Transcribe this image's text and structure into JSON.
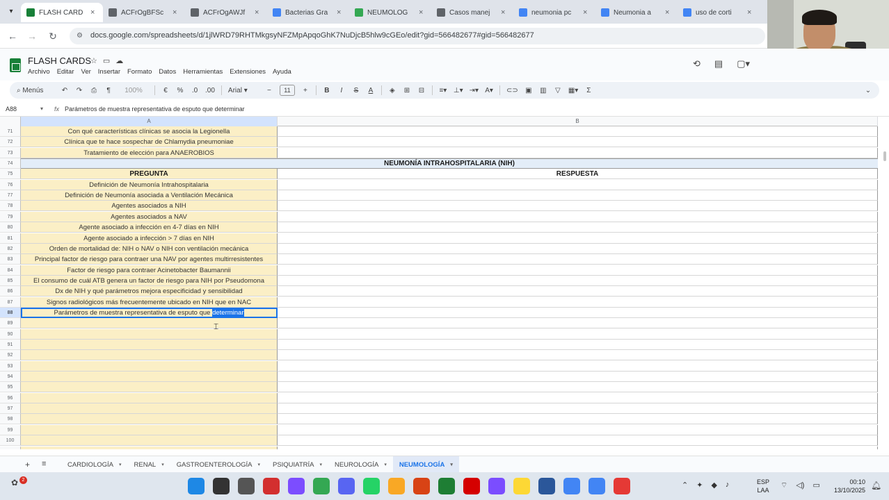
{
  "browser": {
    "tabs": [
      {
        "label": "FLASH CARD",
        "icon": "sheets-icon",
        "color": "#188038",
        "active": true
      },
      {
        "label": "ACFrOgBFSc",
        "icon": "link-icon",
        "color": "#5f6368"
      },
      {
        "label": "ACFrOgAWJf",
        "icon": "link-icon",
        "color": "#5f6368"
      },
      {
        "label": "Bacterias Gra",
        "icon": "doc-icon",
        "color": "#4285f4"
      },
      {
        "label": "NEUMOLOG",
        "icon": "drive-icon",
        "color": "#34a853"
      },
      {
        "label": "Casos manej",
        "icon": "gear-icon",
        "color": "#5f6368"
      },
      {
        "label": "neumonia pc",
        "icon": "google-icon",
        "color": "#4285f4"
      },
      {
        "label": "Neumonia a",
        "icon": "doc-icon",
        "color": "#4285f4"
      },
      {
        "label": "uso de corti",
        "icon": "google-icon",
        "color": "#4285f4"
      }
    ],
    "url": "docs.google.com/spreadsheets/d/1jlWRD79RHTMkgsyNFZMpApqoGhK7NuDjcB5hlw9cGEo/edit?gid=566482677#gid=566482677"
  },
  "app": {
    "title": "FLASH CARDS",
    "menu": [
      "Archivo",
      "Editar",
      "Ver",
      "Insertar",
      "Formato",
      "Datos",
      "Herramientas",
      "Extensiones",
      "Ayuda"
    ]
  },
  "toolbar": {
    "search_label": "Menús",
    "zoom": "100%",
    "font": "Arial",
    "font_size": "11",
    "currency": "€",
    "percent": "%",
    "dec_decrease": ".0",
    "dec_increase": ".00",
    "minus": "−",
    "plus": "+",
    "bold": "B",
    "italic": "I",
    "strike": "S",
    "text_color": "A",
    "sigma": "Σ"
  },
  "formula_bar": {
    "cell_ref": "A88",
    "content": "Parámetros de muestra representativa de esputo que determinar"
  },
  "columns": [
    "A",
    "B"
  ],
  "rows": [
    {
      "num": "71",
      "a": "Con qué características clínicas se asocia la Legionella"
    },
    {
      "num": "72",
      "a": "Clínica que te hace sospechar de Chlamydia pneumoniae"
    },
    {
      "num": "73",
      "a": "Tratamiento de elección para ANAEROBIOS"
    },
    {
      "num": "74",
      "merged": "NEUMONÍA INTRAHOSPITALARIA (NIH)"
    },
    {
      "num": "75",
      "a": "PREGUNTA",
      "b": "RESPUESTA",
      "header": true
    },
    {
      "num": "76",
      "a": "Definición de Neumonía Intrahospitalaria"
    },
    {
      "num": "77",
      "a": "Definición de Neumonía asociada a Ventilación Mecánica"
    },
    {
      "num": "78",
      "a": "Agentes asociados a NIH"
    },
    {
      "num": "79",
      "a": "Agentes asociados a NAV"
    },
    {
      "num": "80",
      "a": "Agente asociado a infección en 4-7 días en NIH"
    },
    {
      "num": "81",
      "a": "Agente asociado a infección > 7 días en NIH"
    },
    {
      "num": "82",
      "a": "Orden de mortalidad de: NIH o NAV o NIH con ventilación mecánica"
    },
    {
      "num": "83",
      "a": "Principal factor de riesgo para contraer una NAV por agentes multirresistentes"
    },
    {
      "num": "84",
      "a": "Factor de riesgo para contraer Acinetobacter Baumannii"
    },
    {
      "num": "85",
      "a": "El consumo de cuál ATB genera un factor de riesgo para NIH por Pseudomona"
    },
    {
      "num": "86",
      "a": "Dx de NIH y qué parámetros mejora especificidad y sensibilidad"
    },
    {
      "num": "87",
      "a": "Signos radiológicos más frecuentemente ubicado en NIH que en NAC"
    },
    {
      "num": "88",
      "a_pre": "Parámetros de muestra representativa de esputo que ",
      "a_sel": "determinar",
      "active": true
    },
    {
      "num": "89"
    },
    {
      "num": "90"
    },
    {
      "num": "91"
    },
    {
      "num": "92"
    },
    {
      "num": "93"
    },
    {
      "num": "94"
    },
    {
      "num": "95"
    },
    {
      "num": "96"
    },
    {
      "num": "97"
    },
    {
      "num": "98"
    },
    {
      "num": "99"
    },
    {
      "num": "100"
    },
    {
      "num": "101"
    }
  ],
  "sheets": [
    {
      "label": "CARDIOLOGÍA"
    },
    {
      "label": "RENAL"
    },
    {
      "label": "GASTROENTEROLOGÍA"
    },
    {
      "label": "PSIQUIATRÍA"
    },
    {
      "label": "NEUROLOGÍA"
    },
    {
      "label": "NEUMOLOGÍA",
      "active": true
    }
  ],
  "taskbar": {
    "notification_count": "2",
    "language_line1": "ESP",
    "language_line2": "LAA",
    "time": "00:10",
    "date": "13/10/2025",
    "app_colors": [
      "#1e88e5",
      "#333333",
      "#555555",
      "#d32f2f",
      "#7c4dff",
      "#34a853",
      "#5865f2",
      "#25d366",
      "#f9a825",
      "#d84315",
      "#1e7e34",
      "#d50000",
      "#7b4dff",
      "#fdd835",
      "#2b579a",
      "#4285f4",
      "#4285f4",
      "#e53935"
    ]
  }
}
